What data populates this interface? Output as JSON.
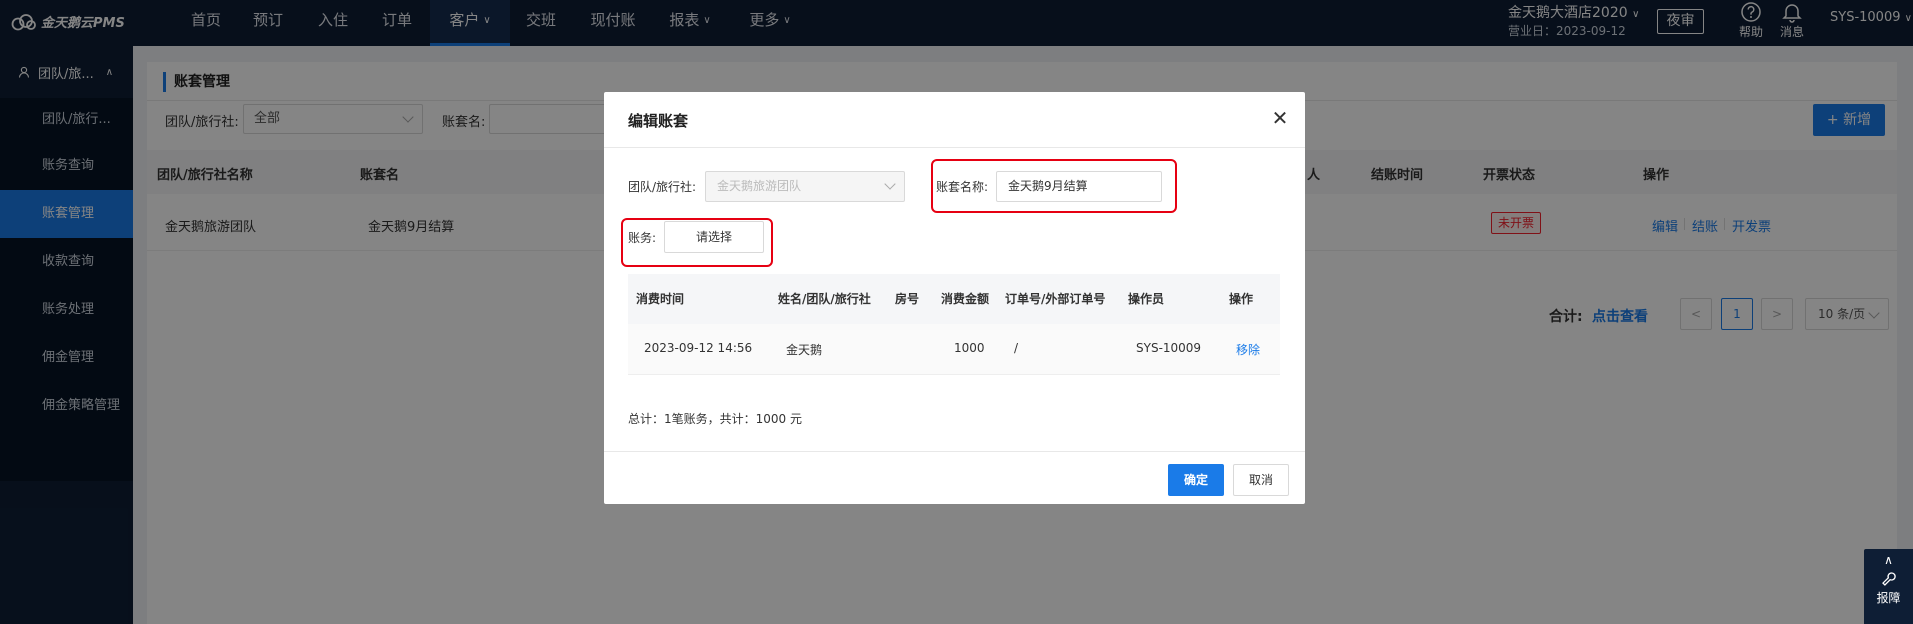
{
  "app": {
    "logo_text": "金天鹅云PMS",
    "nav": [
      {
        "label": "首页"
      },
      {
        "label": "预订"
      },
      {
        "label": "入住"
      },
      {
        "label": "订单"
      },
      {
        "label": "客户"
      },
      {
        "label": "交班"
      },
      {
        "label": "现付账"
      },
      {
        "label": "报表"
      },
      {
        "label": "更多"
      }
    ],
    "hotel_name": "金天鹅大酒店2020",
    "business_date": "营业日：2023-09-12",
    "night_audit_label": "夜审",
    "help_label": "帮助",
    "message_label": "消息",
    "user": "SYS-10009"
  },
  "sidebar": {
    "group_label": "团队/旅...",
    "items": [
      {
        "label": "团队/旅行..."
      },
      {
        "label": "账务查询"
      },
      {
        "label": "账套管理"
      },
      {
        "label": "收款查询"
      },
      {
        "label": "账务处理"
      },
      {
        "label": "佣金管理"
      },
      {
        "label": "佣金策略管理"
      }
    ]
  },
  "page": {
    "title": "账套管理",
    "filter_team_label": "团队/旅行社:",
    "filter_team_value": "全部",
    "filter_name_label": "账套名:",
    "add_button": "+ 新增",
    "columns": {
      "team": "团队/旅行社名称",
      "name": "账套名",
      "person_partial": "人",
      "settle_time": "结账时间",
      "invoice_status": "开票状态",
      "actions": "操作"
    },
    "rows": [
      {
        "team": "金天鹅旅游团队",
        "name": "金天鹅9月结算",
        "invoice_status": "未开票",
        "edit": "编辑",
        "settle": "结账",
        "invoice": "开发票"
      }
    ],
    "total_label": "合计:",
    "total_link": "点击查看",
    "current_page": "1",
    "page_size": "10 条/页"
  },
  "modal": {
    "title": "编辑账套",
    "team_label": "团队/旅行社:",
    "team_value": "金天鹅旅游团队",
    "name_label": "账套名称:",
    "name_value": "金天鹅9月结算",
    "account_label": "账务:",
    "account_button": "请选择",
    "columns": {
      "time": "消费时间",
      "name": "姓名/团队/旅行社",
      "room": "房号",
      "amount": "消费金额",
      "order": "订单号/外部订单号",
      "operator": "操作员",
      "action": "操作"
    },
    "rows": [
      {
        "time": "2023-09-12 14:56",
        "name": "金天鹅",
        "room": "",
        "amount": "1000",
        "order": "/",
        "operator": "SYS-10009",
        "action": "移除"
      }
    ],
    "summary": "总计：1笔账务，共计：1000 元",
    "ok_label": "确定",
    "cancel_label": "取消"
  },
  "float_widget": {
    "report_label": "报障"
  },
  "colors": {
    "nav_bg": "#0e1e35",
    "accent": "#1a7be8",
    "highlight": "#e60012",
    "status_red": "#f5222d"
  }
}
